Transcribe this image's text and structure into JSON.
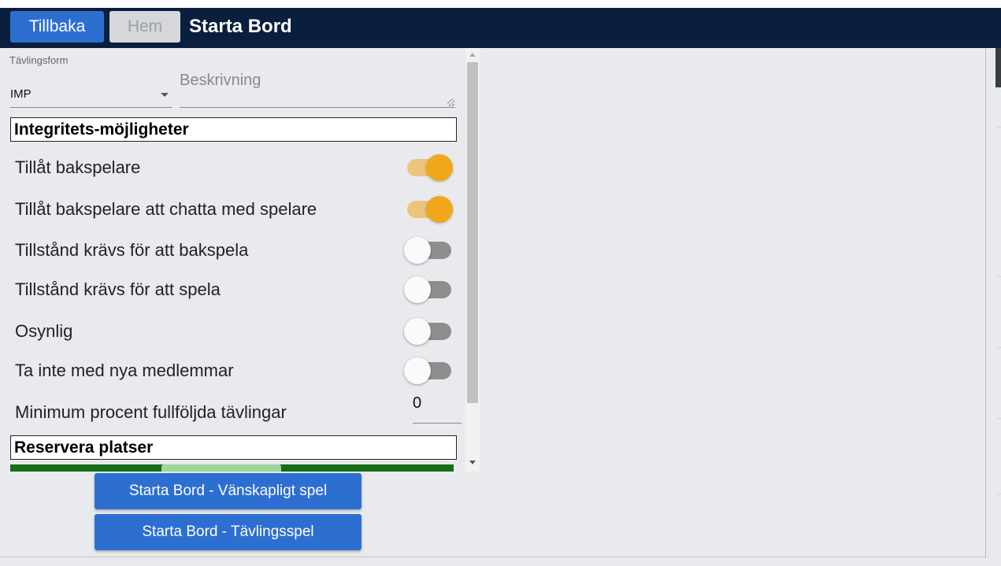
{
  "header": {
    "back_label": "Tillbaka",
    "home_label": "Hem",
    "title": "Starta Bord"
  },
  "form": {
    "competition_label": "Tävlingsform",
    "competition_value": "IMP",
    "description_placeholder": "Beskrivning",
    "description_value": ""
  },
  "integrity": {
    "header": "Integritets-möjligheter",
    "options": [
      {
        "label": "Tillåt bakspelare",
        "on": true
      },
      {
        "label": "Tillåt bakspelare att chatta med spelare",
        "on": true
      },
      {
        "label": "Tillstånd krävs för att bakspela",
        "on": false
      },
      {
        "label": "Tillstånd krävs för att spela",
        "on": false
      },
      {
        "label": "Osynlig",
        "on": false
      },
      {
        "label": "Ta inte med nya medlemmar",
        "on": false
      }
    ],
    "min_percent_label": "Minimum procent fullföljda tävlingar",
    "min_percent_value": "0"
  },
  "reserve": {
    "header": "Reservera platser"
  },
  "actions": {
    "friendly_label": "Starta Bord - Vänskapligt spel",
    "competitive_label": "Starta Bord - Tävlingsspel"
  },
  "colors": {
    "header_bg": "#0a1f3d",
    "button_blue": "#2d6fd1",
    "toggle_on": "#f0a81a",
    "reserve_green": "#156d17"
  }
}
